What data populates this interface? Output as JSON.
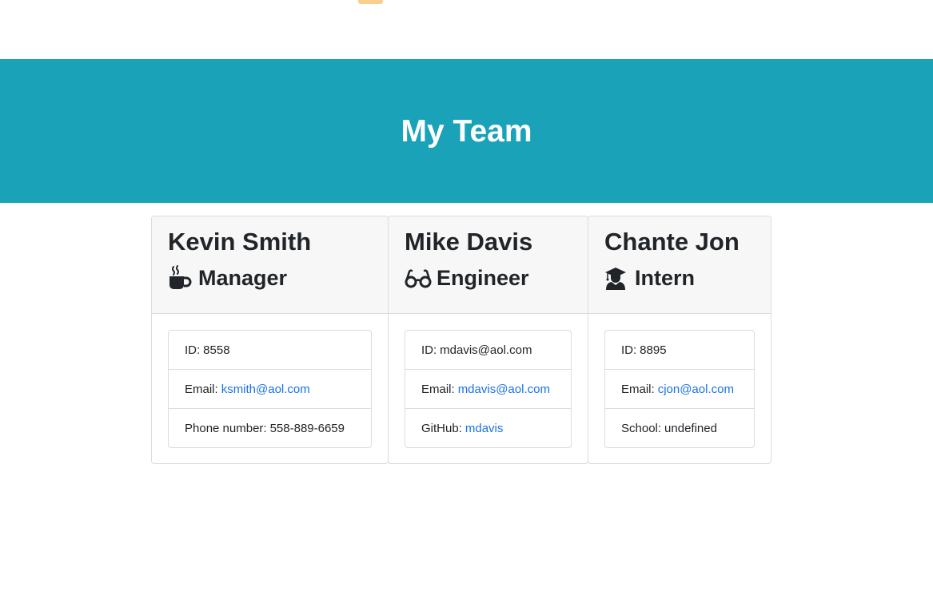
{
  "header": {
    "title": "My Team"
  },
  "colors": {
    "header_bg": "#19a2b8",
    "link": "#1a73e8",
    "accent": "#f8cf8c"
  },
  "team": [
    {
      "name": "Kevin Smith",
      "role": "Manager",
      "role_icon": "coffee-mug-icon",
      "id_label": "ID:",
      "id_value": "8558",
      "email_label": "Email:",
      "email": "ksmith@aol.com",
      "extra_label": "Phone number:",
      "extra_value": "558-889-6659"
    },
    {
      "name": "Mike Davis",
      "role": "Engineer",
      "role_icon": "glasses-icon",
      "id_label": "ID:",
      "id_value": "mdavis@aol.com",
      "email_label": "Email:",
      "email": "mdavis@aol.com",
      "extra_label": "GitHub:",
      "extra_value": "mdavis"
    },
    {
      "name": "Chante Jon",
      "role": "Intern",
      "role_icon": "graduate-icon",
      "id_label": "ID:",
      "id_value": "8895",
      "email_label": "Email:",
      "email": "cjon@aol.com",
      "extra_label": "School:",
      "extra_value": "undefined"
    }
  ]
}
